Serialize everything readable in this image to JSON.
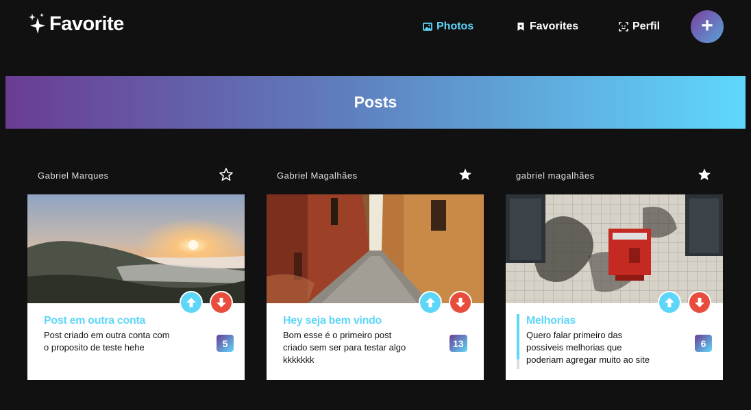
{
  "app": {
    "logo": "Favorite"
  },
  "nav": {
    "photos": "Photos",
    "favorites": "Favorites",
    "perfil": "Perfil"
  },
  "add_button": "+",
  "banner": {
    "title": "Posts"
  },
  "colors": {
    "accent": "#5dd6f8",
    "downvote": "#e74c3c",
    "gradient_start": "#6a3c93",
    "gradient_end": "#5fd7fb"
  },
  "posts": [
    {
      "author": "Gabriel Marques",
      "starred": false,
      "title": "Post em outra conta",
      "description": "Post criado em outra conta com o proposito de teste hehe",
      "votes": "5"
    },
    {
      "author": "Gabriel Magalhães",
      "starred": true,
      "title": "Hey seja bem vindo",
      "description": "Bom esse é o primeiro post criado sem ser para testar algo kkkkkkk",
      "votes": "13"
    },
    {
      "author": "gabriel magalhães",
      "starred": true,
      "title": "Melhorias",
      "description": "Quero falar primeiro das possíveis melhorias que poderiam agregar muito ao site",
      "votes": "6"
    }
  ]
}
